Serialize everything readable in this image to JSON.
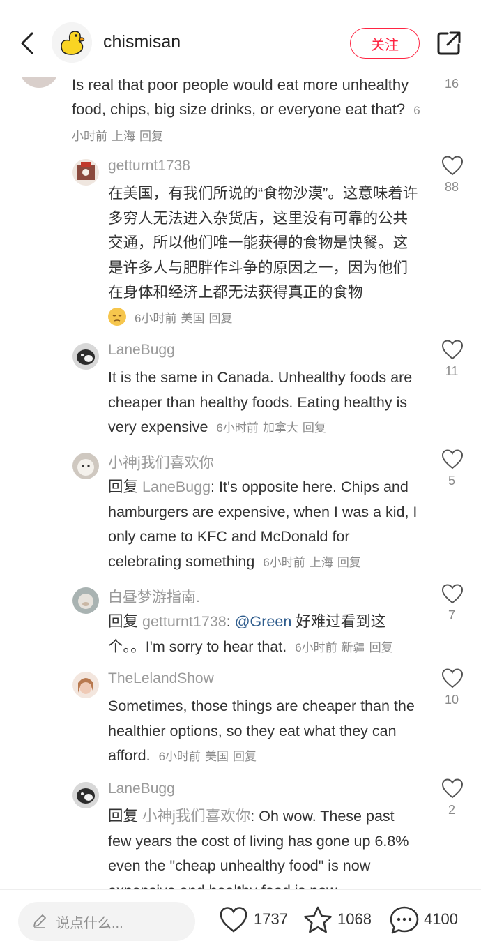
{
  "header": {
    "username": "chismisan",
    "follow_label": "关注"
  },
  "top_comment": {
    "text": "Is real that poor people would eat more unhealthy food, chips, big size drinks, or everyone eat that?",
    "time": "6小时前",
    "location": "上海",
    "reply_label": "回复",
    "likes": "16"
  },
  "replies": [
    {
      "name": "getturnt1738",
      "text": "在美国，有我们所说的“食物沙漠”。这意味着许多穷人无法进入杂货店，这里没有可靠的公共交通，所以他们唯一能获得的食物是快餐。这是许多人与肥胖作斗争的原因之一，因为他们在身体和经济上都无法获得真正的食物",
      "emoji": "pensive-face",
      "time": "6小时前",
      "location": "美国",
      "reply_label": "回复",
      "likes": "88",
      "avatar_color": "#8b4a3e"
    },
    {
      "name": "LaneBugg",
      "text": "It is the same in Canada. Unhealthy foods are cheaper than healthy foods. Eating healthy is very expensive",
      "time": "6小时前",
      "location": "加拿大",
      "reply_label": "回复",
      "likes": "11",
      "avatar_color": "#3a3a3a"
    },
    {
      "name": "小神j我们喜欢你",
      "reply_prefix": "回复",
      "reply_to": "LaneBugg",
      "text": ": It's opposite here. Chips and hamburgers are expensive, when I was a kid, I only came to KFC and McDonald for celebrating something",
      "time": "6小时前",
      "location": "上海",
      "reply_label": "回复",
      "likes": "5",
      "avatar_color": "#e8e2dc"
    },
    {
      "name": "白昼梦游指南.",
      "reply_prefix": "回复",
      "reply_to": "getturnt1738",
      "text_pre": ": ",
      "mention": "@Green",
      "text": " 好难过看到这个。。I'm sorry to hear that.",
      "time": "6小时前",
      "location": "新疆",
      "reply_label": "回复",
      "likes": "7",
      "avatar_color": "#b9bfbe"
    },
    {
      "name": "TheLelandShow",
      "text": "Sometimes, those things are cheaper than the healthier options, so they eat what they can afford.",
      "time": "6小时前",
      "location": "美国",
      "reply_label": "回复",
      "likes": "10",
      "avatar_color": "#e9c8b8"
    },
    {
      "name": "LaneBugg",
      "reply_prefix": "回复",
      "reply_to": "小神j我们喜欢你",
      "text": ": Oh wow. These past few years the cost of living has gone up 6.8% even the \"cheap unhealthy food\" is now expensive and healthy food is now",
      "likes": "2",
      "avatar_color": "#3a3a3a"
    }
  ],
  "bottom_bar": {
    "input_placeholder": "说点什么...",
    "likes": "1737",
    "favorites": "1068",
    "comments": "4100"
  }
}
